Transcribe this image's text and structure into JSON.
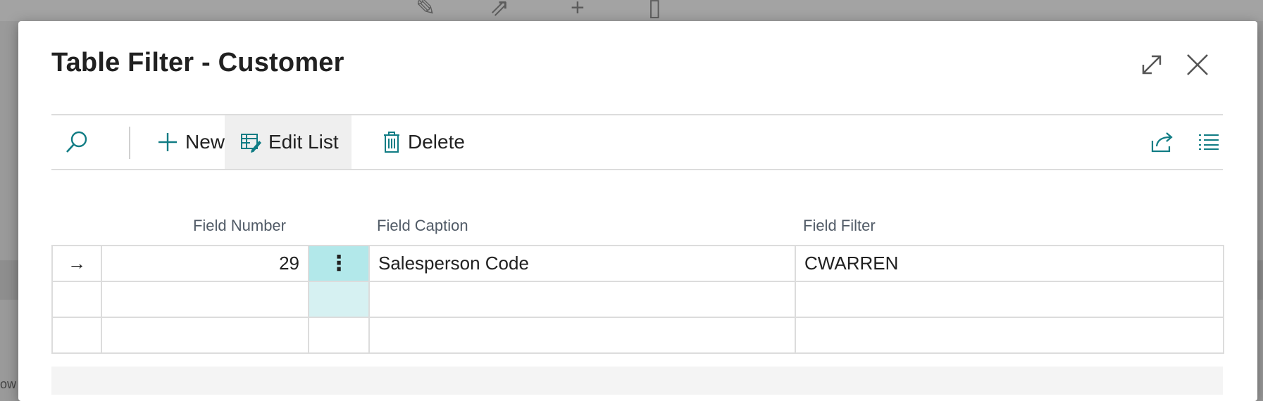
{
  "background": {
    "icons": [
      "pencil-icon",
      "share-icon",
      "plus-icon",
      "trash-icon"
    ],
    "partial_text": "ow"
  },
  "dialog": {
    "title": "Table Filter - Customer",
    "expand_icon": "expand-icon",
    "close_icon": "close-icon"
  },
  "toolbar": {
    "search_icon": "search-icon",
    "new_label": "New",
    "edit_list_label": "Edit List",
    "delete_label": "Delete",
    "share_icon": "share-icon",
    "list_icon": "list-view-icon",
    "accent_color": "#107c84"
  },
  "grid": {
    "columns": {
      "field_number": "Field Number",
      "field_caption": "Field Caption",
      "field_filter": "Field Filter"
    },
    "rows": [
      {
        "selected": true,
        "row_indicator": "→",
        "field_number": "29",
        "menu": "⋮",
        "field_caption": "Salesperson Code",
        "field_filter": "CWARREN"
      },
      {
        "selected": false,
        "row_indicator": "",
        "field_number": "",
        "menu": "",
        "field_caption": "",
        "field_filter": ""
      },
      {
        "selected": false,
        "row_indicator": "",
        "field_number": "",
        "menu": "",
        "field_caption": "",
        "field_filter": ""
      }
    ]
  }
}
